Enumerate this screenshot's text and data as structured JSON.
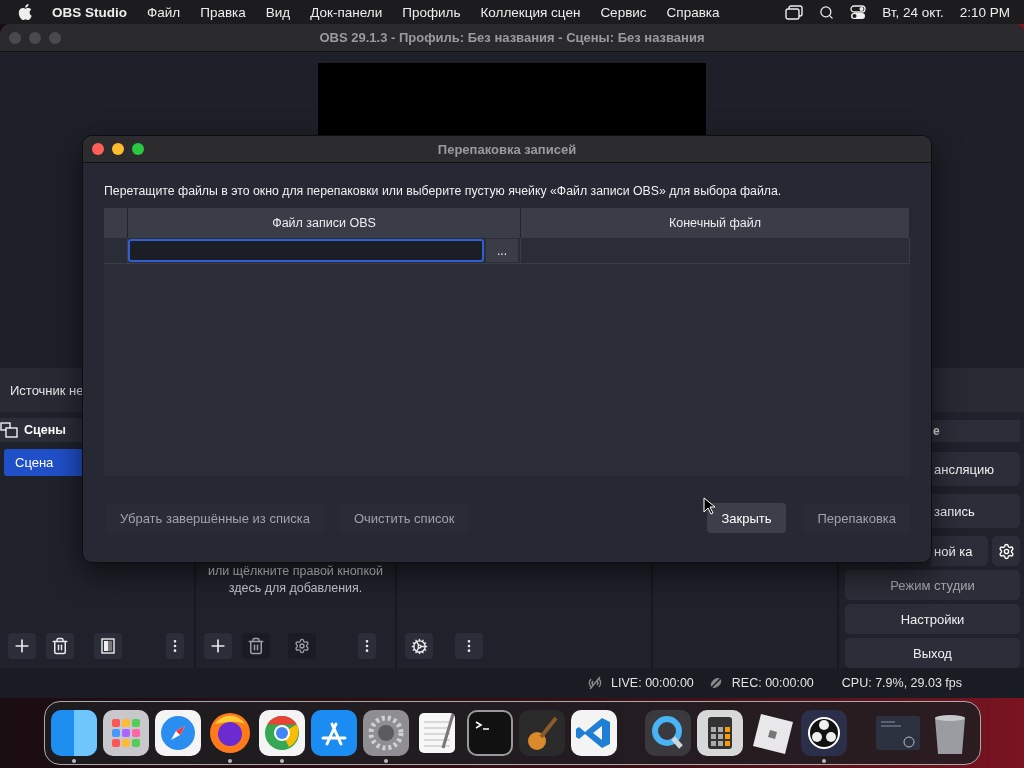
{
  "menu_bar": {
    "app_name": "OBS Studio",
    "menus": [
      "Файл",
      "Правка",
      "Вид",
      "Док-панели",
      "Профиль",
      "Коллекция сцен",
      "Сервис",
      "Справка"
    ],
    "date": "Вт, 24 окт.",
    "time": "2:10 PM"
  },
  "window": {
    "title": "OBS 29.1.3 - Профиль: Без названия - Сцены: Без названия"
  },
  "source_toolbar": {
    "label": "Источник не"
  },
  "scenes_dock": {
    "title": "Сцены",
    "scenes": [
      {
        "name": "Сцена",
        "selected": true
      }
    ]
  },
  "sources_dock": {
    "hint_lines": [
      "или щёлкните правой кнопкой",
      "здесь для добавления."
    ]
  },
  "controls_dock": {
    "title": "е",
    "buttons": [
      {
        "label": "ансляцию",
        "kind": "partial"
      },
      {
        "label": "запись",
        "kind": "partial"
      },
      {
        "label": "ной ка",
        "kind": "partial_settings"
      },
      {
        "label": "Режим студии",
        "kind": "full",
        "disabled": true
      },
      {
        "label": "Настройки",
        "kind": "full",
        "disabled": false
      },
      {
        "label": "Выход",
        "kind": "full",
        "disabled": false
      }
    ]
  },
  "status_bar": {
    "live": "LIVE: 00:00:00",
    "rec": "REC: 00:00:00",
    "cpu": "CPU: 7.9%, 29.03 fps"
  },
  "dialog": {
    "title": "Перепаковка записей",
    "instruction": "Перетащите файлы в это окно для перепаковки или выберите пустую ячейку «Файл записи OBS» для выбора файла.",
    "columns": [
      "Файл записи OBS",
      "Конечный файл"
    ],
    "rows": [
      {
        "browse": "...",
        "focused": true
      }
    ],
    "left_buttons": [
      {
        "label": "Убрать завершённые из списка",
        "disabled": true
      },
      {
        "label": "Очистить список",
        "disabled": true
      }
    ],
    "right_buttons": [
      {
        "label": "Закрыть",
        "disabled": false
      },
      {
        "label": "Перепаковка",
        "disabled": true
      }
    ]
  },
  "dock": {
    "apps": [
      {
        "kind": "finder",
        "running": true
      },
      {
        "kind": "launchpad",
        "running": false
      },
      {
        "kind": "safari",
        "running": false
      },
      {
        "kind": "firefox",
        "running": true
      },
      {
        "kind": "chrome",
        "running": true
      },
      {
        "kind": "appstore",
        "running": false
      },
      {
        "kind": "settings",
        "running": true
      },
      {
        "kind": "textedit",
        "running": false
      },
      {
        "kind": "terminal",
        "running": false
      },
      {
        "kind": "guitar",
        "running": false
      },
      {
        "kind": "vscode",
        "running": false
      },
      {
        "kind": "separator"
      },
      {
        "kind": "quicktime",
        "running": false
      },
      {
        "kind": "calculator",
        "running": false
      },
      {
        "kind": "cube",
        "running": false
      },
      {
        "kind": "obs",
        "running": true
      },
      {
        "kind": "separator"
      },
      {
        "kind": "thumbnail",
        "running": false
      },
      {
        "kind": "trash",
        "running": false
      }
    ]
  }
}
